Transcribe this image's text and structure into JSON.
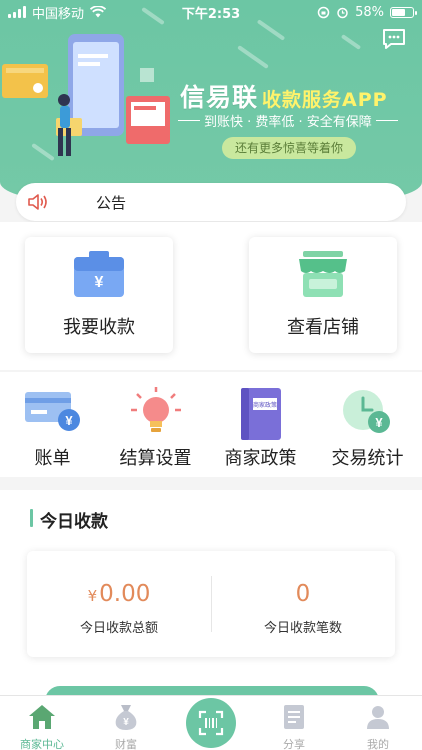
{
  "statusbar": {
    "carrier": "中国移动",
    "time": "下午2:53",
    "battery": "58%"
  },
  "banner": {
    "title_main": "信易联",
    "title_sub": "收款服务APP",
    "slogan": "到账快 · 费率低 · 安全有保障",
    "pill": "还有更多惊喜等着你"
  },
  "notice": {
    "label": "公告"
  },
  "big_cards": [
    {
      "label": "我要收款",
      "icon": "wallet-icon"
    },
    {
      "label": "查看店铺",
      "icon": "store-icon"
    }
  ],
  "menu": [
    {
      "label": "账单",
      "icon": "bill-icon"
    },
    {
      "label": "结算设置",
      "icon": "lightbulb-icon"
    },
    {
      "label": "商家政策",
      "icon": "book-icon",
      "book_text": "商家政策"
    },
    {
      "label": "交易统计",
      "icon": "clock-icon"
    }
  ],
  "today": {
    "title": "今日收款",
    "amount_symbol": "¥",
    "amount": "0.00",
    "amount_caption": "今日收款总额",
    "count": "0",
    "count_caption": "今日收款笔数"
  },
  "tabbar": [
    {
      "label": "商家中心",
      "icon": "home-icon",
      "active": true
    },
    {
      "label": "财富",
      "icon": "money-bag-icon",
      "active": false
    },
    {
      "label": "",
      "icon": "scan-icon",
      "active": false
    },
    {
      "label": "分享",
      "icon": "share-doc-icon",
      "active": false
    },
    {
      "label": "我的",
      "icon": "user-icon",
      "active": false
    }
  ],
  "colors": {
    "brand_green": "#6cc6a4",
    "amount_orange": "#e28a5a",
    "slogan_yellow": "#fff36b"
  }
}
